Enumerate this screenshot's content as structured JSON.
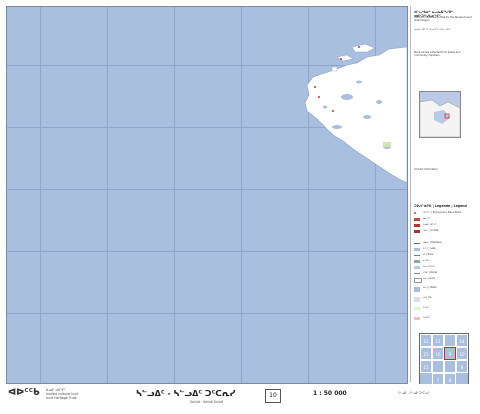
{
  "map": {
    "top_ticks": [
      "",
      "",
      "",
      "",
      "",
      "",
      ""
    ],
    "bottom_ticks": [
      "",
      "",
      "",
      "",
      "",
      "",
      ""
    ]
  },
  "legend": {
    "heading": "ᐊᓪᓚᒃᑲᓂᒃ ᓇᓗᓇᐃᖅᓯᕕᒃ ᐊᕕᒃᑐᖅᓯᒪᓂᖏᑦ",
    "intro": "The Inuit Place Name Map for the Nunavut Land Claim Region",
    "paragraphs": [
      "ᓄᓇᕗᑦ ᐊᑎᖏᑦ ᐅᓄᖅᑐᑦ ᐱᕙᓪᓕᐊᔪᑦ",
      "Place names collected from elders and community members",
      "Contact information"
    ],
    "legend_heading": "ᑐᑭᓯᒋᐊᕈᑎ | Legende | Legend",
    "items": [
      {
        "label": "ᐊᑎᖏᑦ | Toponymes | Place Name",
        "color": "#d33"
      },
      {
        "label": "ᐃᓂᖏᑦ",
        "color": "#c44"
      },
      {
        "label": "ᐃᓄᐃᑦ ᐊᑎᖏᑦ",
        "color": "#b33"
      },
      {
        "label": "ᓴᐃᓕᑦ | Limite",
        "color": "#a33"
      },
      {
        "label": "ᐊᑯᓃᑦ | Elevation",
        "color": "#666"
      },
      {
        "label": "ᑕᓯᖅ | Lake",
        "color": "#a9bfe0"
      },
      {
        "label": "ᑰᒃ | River",
        "color": "#5c7fb8"
      },
      {
        "label": "ᓇᑦᑎᓕᒃ",
        "color": "#8aa"
      },
      {
        "label": "ᐱᓕᕆᐊᖑᔪᑦ",
        "color": "#bcd"
      },
      {
        "label": "ᐊᖁᑦ | Route",
        "color": "#888"
      },
      {
        "label": "ᓄᓇ | Land",
        "color": "#ffffff"
      },
      {
        "label": "ᐃᒪᖅ | Water",
        "color": "#a9bfe0"
      },
      {
        "label": "ᓯᑯ | Ice",
        "color": "#dde"
      },
      {
        "label": "ᐅᔭᕋᒃ",
        "color": "#cfc"
      },
      {
        "label": "ᐱᖁᑎᑦ",
        "color": "#f0c0c0"
      }
    ]
  },
  "index": {
    "cells": [
      "12",
      "13",
      "",
      "14",
      "15",
      "16",
      "9",
      "10",
      "11",
      "",
      "",
      "6",
      "7",
      "8"
    ]
  },
  "footer": {
    "logo": "ᐊᐅᑦᑦᑲ",
    "org_lines": [
      "ᐃᓄᐃᑦ ᐊᑎᖏᑦ",
      "Institut culturel Inuit",
      "Inuit Heritage Trust"
    ],
    "title": "ᓴᓪᓗᐃᑦ - ᓴᓪᓗᐃᑦ ᑐᑦᑕᕆᓯ",
    "subtitle": "Salluit · Salluit Suluit",
    "sheet": "10",
    "scale": "1 : 50 000",
    "right_text": "ᓴᓪᓗᐃᑦ - ᓴᓪᓗᐃᑦ ᑐᑦᑕᕆᓯ"
  }
}
